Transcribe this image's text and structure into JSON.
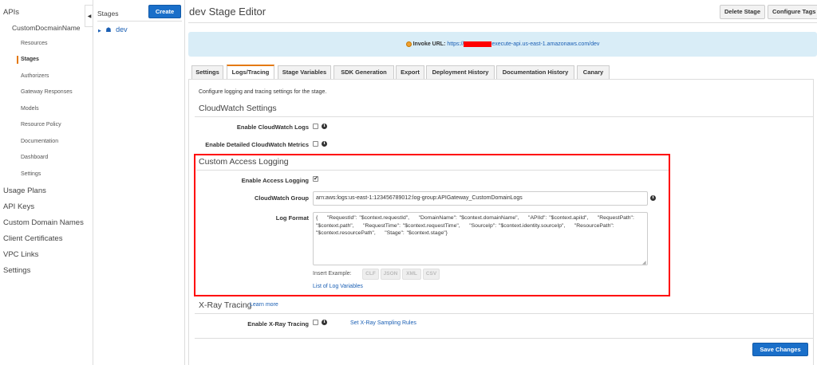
{
  "nav": {
    "apis": "APIs",
    "api_name": "CustomDocmainName",
    "sub": [
      "Resources",
      "Stages",
      "Authorizers",
      "Gateway Responses",
      "Models",
      "Resource Policy",
      "Documentation",
      "Dashboard",
      "Settings"
    ],
    "top": [
      "Usage Plans",
      "API Keys",
      "Custom Domain Names",
      "Client Certificates",
      "VPC Links",
      "Settings"
    ]
  },
  "stages": {
    "title": "Stages",
    "create": "Create",
    "items": [
      "dev"
    ]
  },
  "header": {
    "title": "dev Stage Editor",
    "delete": "Delete Stage",
    "tags": "Configure Tags"
  },
  "invoke": {
    "label": "Invoke URL:",
    "prefix": "https://",
    "suffix": "execute-api.us-east-1.amazonaws.com/dev"
  },
  "tabs": [
    "Settings",
    "Logs/Tracing",
    "Stage Variables",
    "SDK Generation",
    "Export",
    "Deployment History",
    "Documentation History",
    "Canary"
  ],
  "content": {
    "intro": "Configure logging and tracing settings for the stage.",
    "cw_title": "CloudWatch Settings",
    "cw_logs": "Enable CloudWatch Logs",
    "cw_metrics": "Enable Detailed CloudWatch Metrics",
    "cal_title": "Custom Access Logging",
    "enable_access": "Enable Access Logging",
    "access_checked": true,
    "group_label": "CloudWatch Group",
    "group_value": "arn:aws:logs:us-east-1:123456789012:log-group:APIGateway_CustomDomainLogs",
    "format_label": "Log Format",
    "format_value": "{    \"RequestId\": \"$context.requestId\",    \"DomainName\": \"$context.domainName\",    \"APIId\": \"$context.apiId\",    \"RequestPath\": \"$context.path\",    \"RequestTime\": \"$context.requestTime\",    \"SourceIp\": \"$context.identity.sourceIp\",    \"ResourcePath\": \"$context.resourcePath\",    \"Stage\": \"$context.stage\"}",
    "insert_example": "Insert Example:",
    "examples": [
      "CLF",
      "JSON",
      "XML",
      "CSV"
    ],
    "log_vars": "List of Log Variables",
    "xray_title": "X-Ray Tracing",
    "learn_more": "Learn more",
    "xray_enable": "Enable X-Ray Tracing",
    "sampling": "Set X-Ray Sampling Rules",
    "save": "Save Changes"
  },
  "colors": {
    "accent": "#e47911",
    "primary": "#1a6fc9",
    "highlight": "#ff0000"
  }
}
